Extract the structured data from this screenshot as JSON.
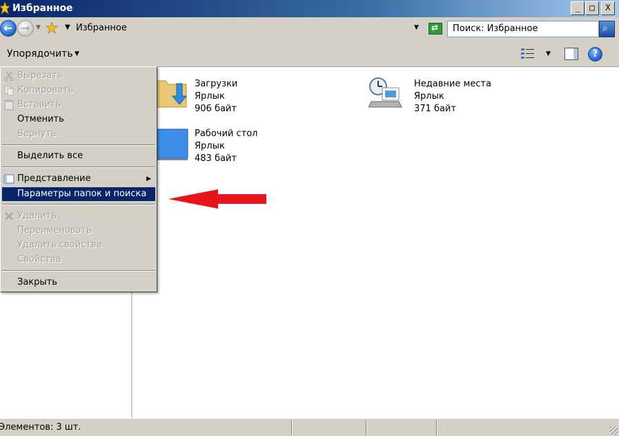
{
  "window": {
    "title": "Избранное",
    "controls": {
      "minimize": "_",
      "maximize": "□",
      "close": "X"
    }
  },
  "addressbar": {
    "path": "Избранное",
    "search_placeholder": "Поиск: Избранное"
  },
  "commandbar": {
    "organize_label": "Упорядочить",
    "help_label": "?"
  },
  "files": [
    {
      "name": "Загрузки",
      "type": "Ярлык",
      "size": "906 байт",
      "icon": "downloads-folder-icon"
    },
    {
      "name": "Недавние места",
      "type": "Ярлык",
      "size": "371 байт",
      "icon": "recent-places-icon"
    },
    {
      "name": "Рабочий стол",
      "type": "Ярлык",
      "size": "483 байт",
      "icon": "desktop-icon"
    }
  ],
  "menu": {
    "items": [
      {
        "label": "Вырезать",
        "disabled": true,
        "icon": "cut-icon"
      },
      {
        "label": "Копировать",
        "disabled": true,
        "icon": "copy-icon"
      },
      {
        "label": "Вставить",
        "disabled": true,
        "icon": "paste-icon"
      },
      {
        "label": "Отменить",
        "disabled": false
      },
      {
        "label": "Вернуть",
        "disabled": true
      },
      {
        "label": "Выделить все",
        "disabled": false
      },
      {
        "label": "Представление",
        "disabled": false,
        "submenu": true,
        "icon": "layout-icon"
      },
      {
        "label": "Параметры папок и поиска",
        "disabled": false,
        "selected": true
      },
      {
        "label": "Удалить",
        "disabled": true,
        "icon": "delete-icon"
      },
      {
        "label": "Переименовать",
        "disabled": true
      },
      {
        "label": "Удалить свойства",
        "disabled": true
      },
      {
        "label": "Свойства",
        "disabled": true
      },
      {
        "label": "Закрыть",
        "disabled": false
      }
    ]
  },
  "statusbar": {
    "text": "Элементов: 3 шт."
  },
  "colors": {
    "titlebar_start": "#0a246a",
    "titlebar_end": "#a6caf0",
    "menu_highlight": "#0a246a",
    "annotation_arrow": "#e8141b"
  }
}
